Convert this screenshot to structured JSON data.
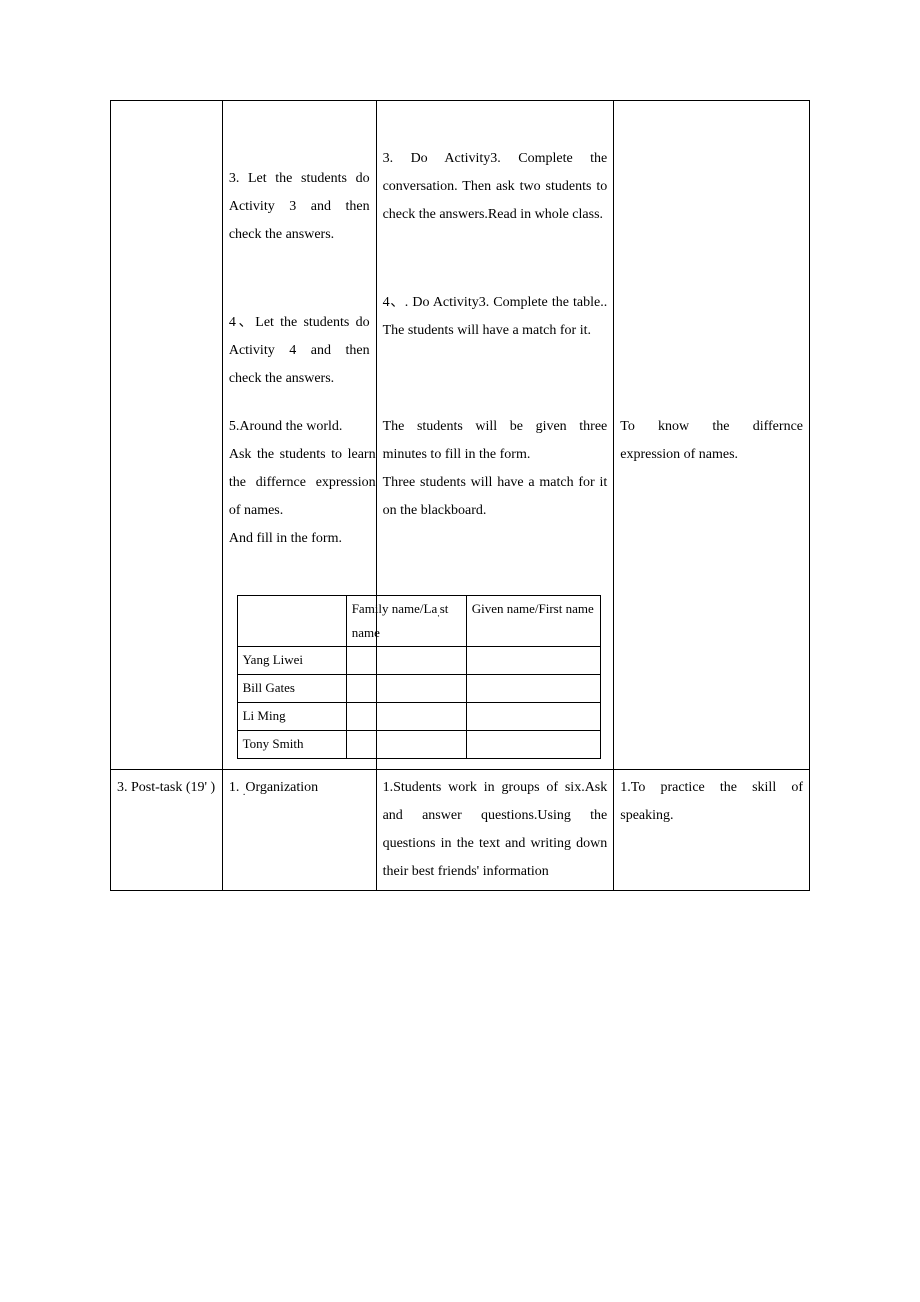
{
  "row1": {
    "teacher_item3": "3. Let the students do Activity 3 and then check the answers.",
    "teacher_item4": "4、Let the students do Activity 4 and then check the answers.",
    "teacher_item5a": "5.Around the world.",
    "teacher_item5b": "Ask the students to learn the differnce expression of names.",
    "teacher_item5c": "And fill in the form.",
    "student_item3": "3. Do Activity3. Complete the conversation. Then ask two students to check the answers.Read in whole class.",
    "student_item4": "4、. Do Activity3. Complete the table.. The students will have a match for it.",
    "student_item5a": "The students will be given three minutes to fill in the form.",
    "student_item5b": "Three students will have a match for it on the blackboard.",
    "purpose_item5": "To know the differnce expression of names.",
    "inner_table": {
      "headers": [
        "",
        "Family name/La",
        "st name",
        "Given name/First name"
      ],
      "header_col2a": "Family name/La",
      "header_col2b": "st name",
      "header_col3": "Given name/First name",
      "rows": [
        "Yang Liwei",
        "Bill Gates",
        "Li Ming",
        "Tony Smith"
      ]
    }
  },
  "row2": {
    "step": "3. Post-task (19' )",
    "teacher_item1a": "1. ",
    "teacher_item1b": "Organization",
    "student_item1": "1.Students work in groups of six.Ask and answer questions.Using the questions in the text and writing down their best friends'  information",
    "purpose_item1": "1.To practice the skill of speaking."
  }
}
